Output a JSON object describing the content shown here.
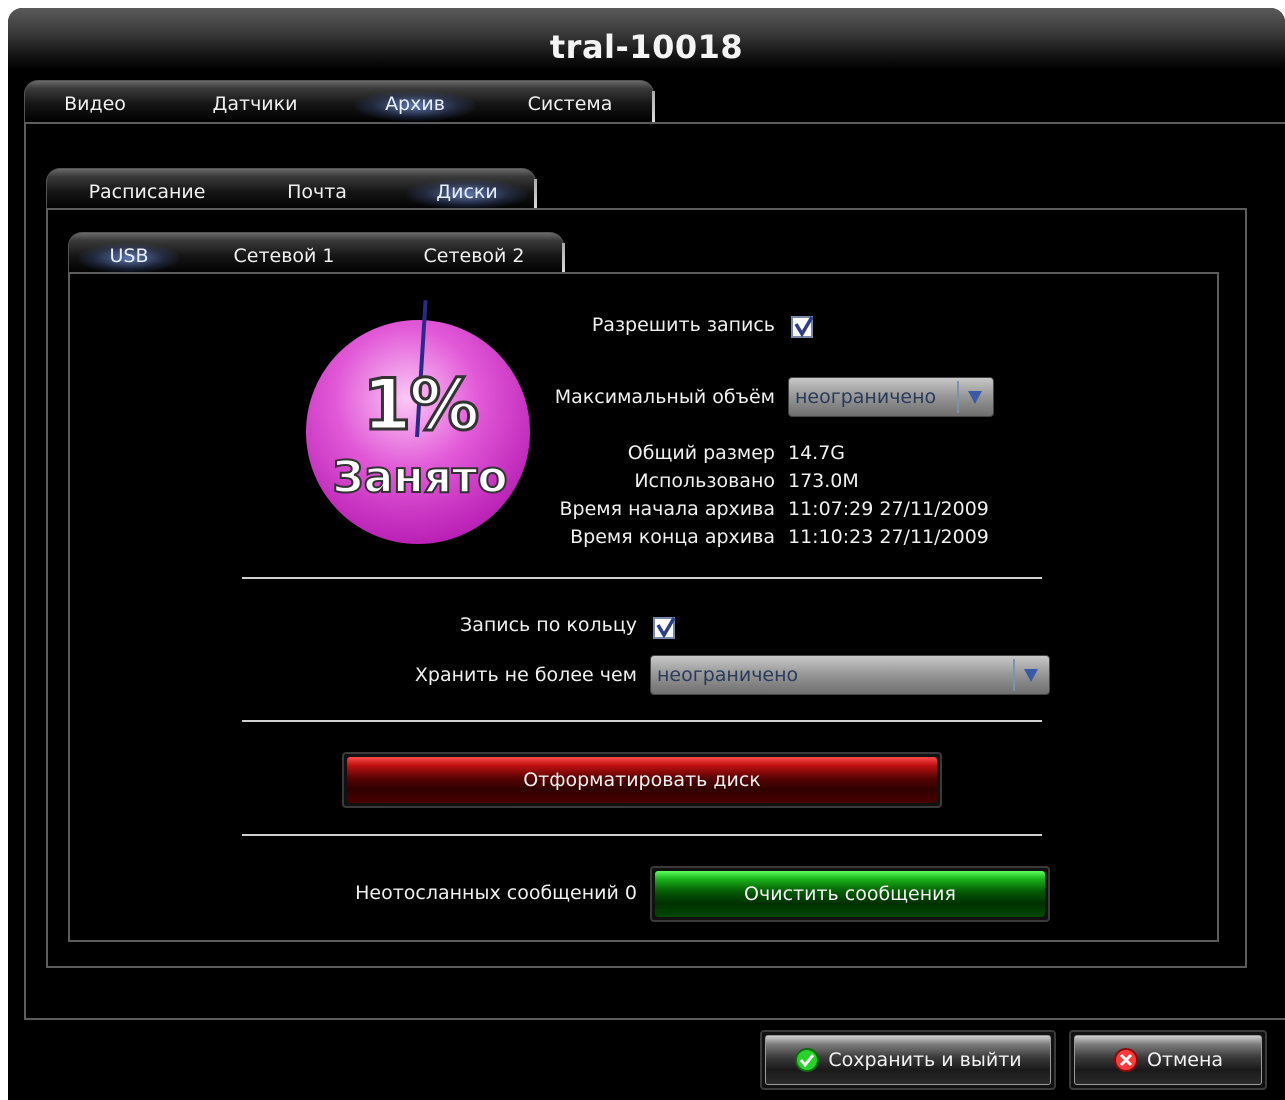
{
  "window": {
    "title": "tral-10018"
  },
  "main_tabs": [
    {
      "label": "Видео",
      "active": false
    },
    {
      "label": "Датчики",
      "active": false
    },
    {
      "label": "Архив",
      "active": true
    },
    {
      "label": "Система",
      "active": false
    }
  ],
  "sub_tabs": [
    {
      "label": "Расписание",
      "active": false
    },
    {
      "label": "Почта",
      "active": false
    },
    {
      "label": "Диски",
      "active": true
    }
  ],
  "disk_tabs": [
    {
      "label": "USB",
      "active": true
    },
    {
      "label": "Сетевой 1",
      "active": false
    },
    {
      "label": "Сетевой 2",
      "active": false
    }
  ],
  "gauge": {
    "percent": 1,
    "percent_label": "1%",
    "caption": "Занято",
    "fill_color": "#e040d8"
  },
  "recording": {
    "allow_label": "Разрешить запись",
    "allow_checked": true,
    "max_size_label": "Максимальный объём",
    "max_size_value": "неограничено"
  },
  "stats": [
    {
      "label": "Общий размер",
      "value": "14.7G"
    },
    {
      "label": "Использовано",
      "value": "173.0M"
    },
    {
      "label": "Время начала архива",
      "value": "11:07:29 27/11/2009"
    },
    {
      "label": "Время конца архива",
      "value": "11:10:23 27/11/2009"
    }
  ],
  "ring": {
    "label": "Запись по кольцу",
    "checked": true,
    "keep_label": "Хранить не более чем",
    "keep_value": "неограничено"
  },
  "format": {
    "button_label": "Отформатировать диск"
  },
  "messages": {
    "unsent_label": "Неотосланных сообщений 0",
    "clear_button_label": "Очистить сообщения"
  },
  "footer": {
    "save_label": "Сохранить и выйти",
    "cancel_label": "Отмена"
  }
}
